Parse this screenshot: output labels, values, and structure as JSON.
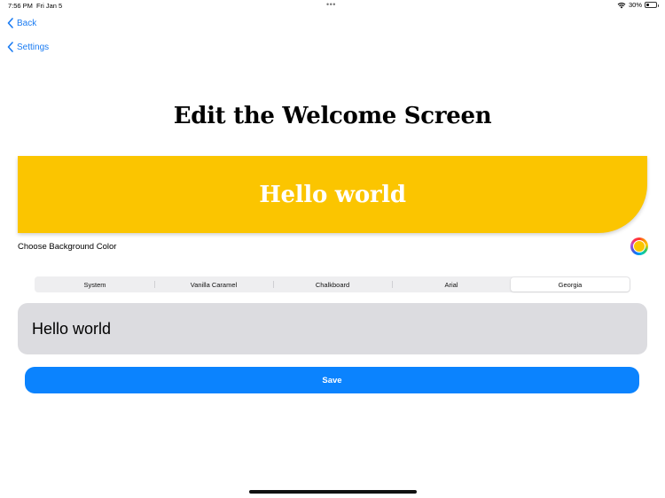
{
  "status_bar": {
    "time": "7:56 PM",
    "date": "Fri Jan 5",
    "dots": "•••",
    "battery": "30%",
    "battery_level": 0.3
  },
  "nav": {
    "back_label": "Back",
    "settings_label": "Settings"
  },
  "title": "Edit the Welcome Screen",
  "preview": {
    "text": "Hello world",
    "background_color": "#fbc500",
    "text_color": "#ffffff"
  },
  "color_picker": {
    "label": "Choose Background Color",
    "selected_color": "#fbc500"
  },
  "font_picker": {
    "options": [
      "System",
      "Vanilla Caramel",
      "Chalkboard",
      "Arial",
      "Georgia"
    ],
    "selected": "Georgia"
  },
  "text_field": {
    "value": "Hello world"
  },
  "save_button": {
    "label": "Save",
    "color": "#0b83fe"
  }
}
